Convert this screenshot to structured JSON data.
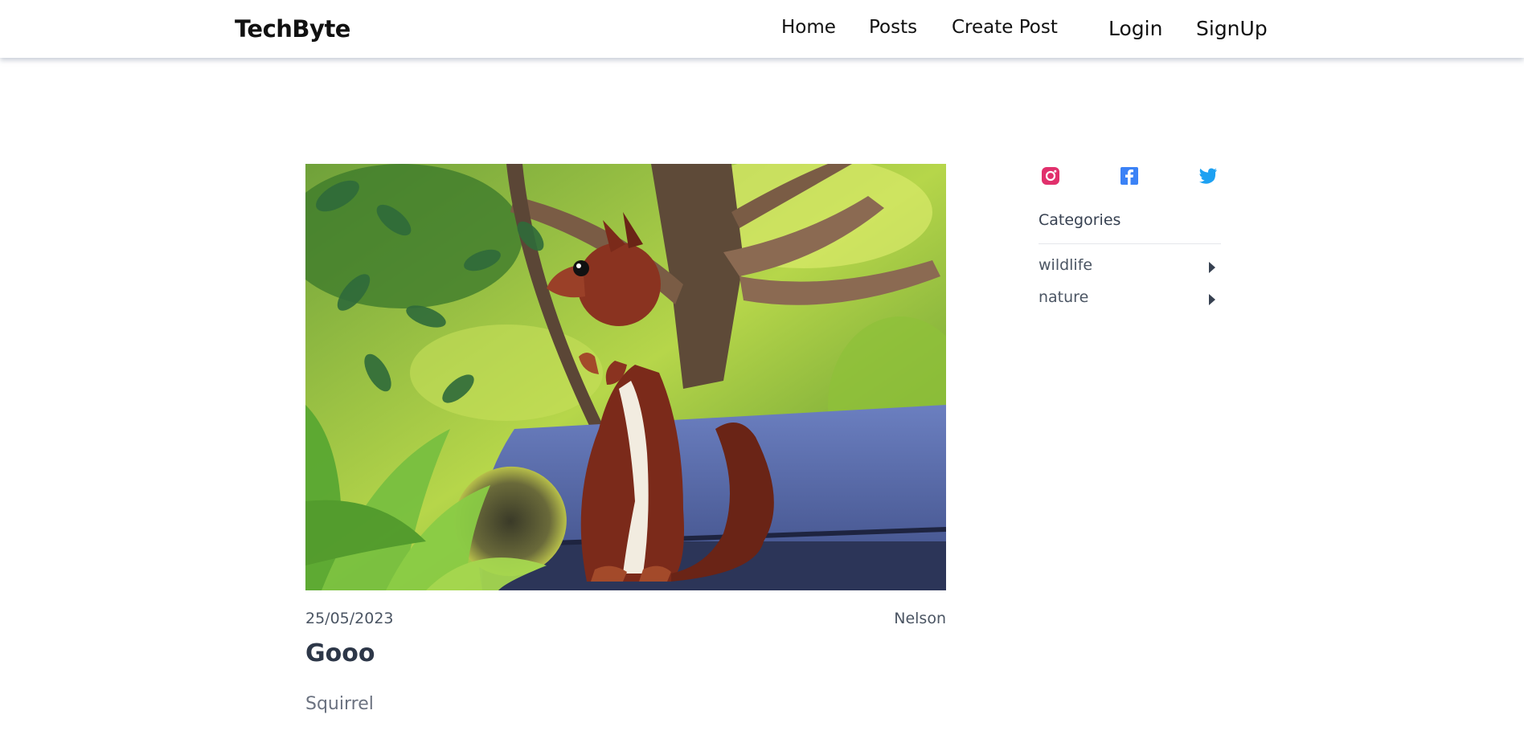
{
  "navbar": {
    "brand": "TechByte",
    "links": [
      "Home",
      "Posts",
      "Create Post"
    ],
    "auth": [
      "Login",
      "SignUp"
    ]
  },
  "post": {
    "image_alt": "Red squirrel standing beside a sunflower head",
    "date": "25/05/2023",
    "author": "Nelson",
    "title": "Gooo",
    "body": "Squirrel"
  },
  "sidebar": {
    "social": [
      {
        "icon": "instagram-icon",
        "color": "#e1306c"
      },
      {
        "icon": "facebook-icon",
        "color": "#3b82f6"
      },
      {
        "icon": "twitter-icon",
        "color": "#1da1f2"
      }
    ],
    "categories_heading": "Categories",
    "categories": [
      "wildlife",
      "nature"
    ]
  }
}
